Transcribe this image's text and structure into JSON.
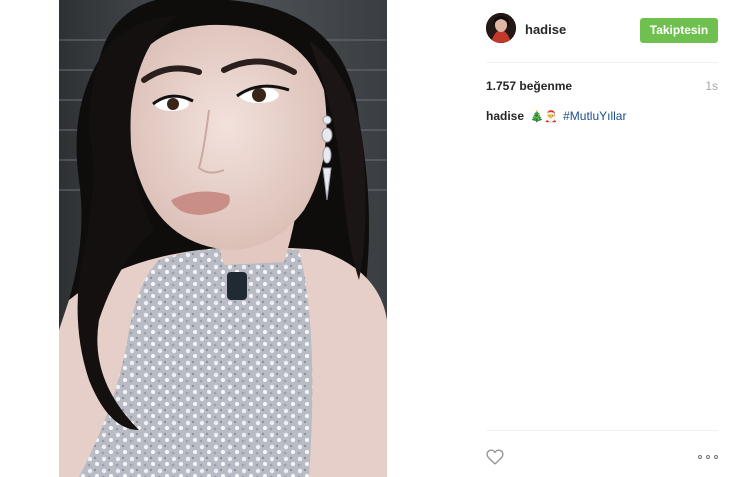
{
  "post": {
    "image_alt": "hadise selfie photo",
    "username": "hadise",
    "follow_label": "Takiptesin",
    "likes_text": "1.757 beğenme",
    "time_text": "1s",
    "caption": {
      "username": "hadise",
      "emoji": "🎄🎅",
      "hashtag": "#MutluYıllar"
    }
  },
  "colors": {
    "follow_button": "#70c050",
    "hashtag": "#1a4f8b",
    "muted": "#a5a7aa"
  },
  "icons": {
    "like": "heart-icon",
    "options": "more-options-icon"
  }
}
